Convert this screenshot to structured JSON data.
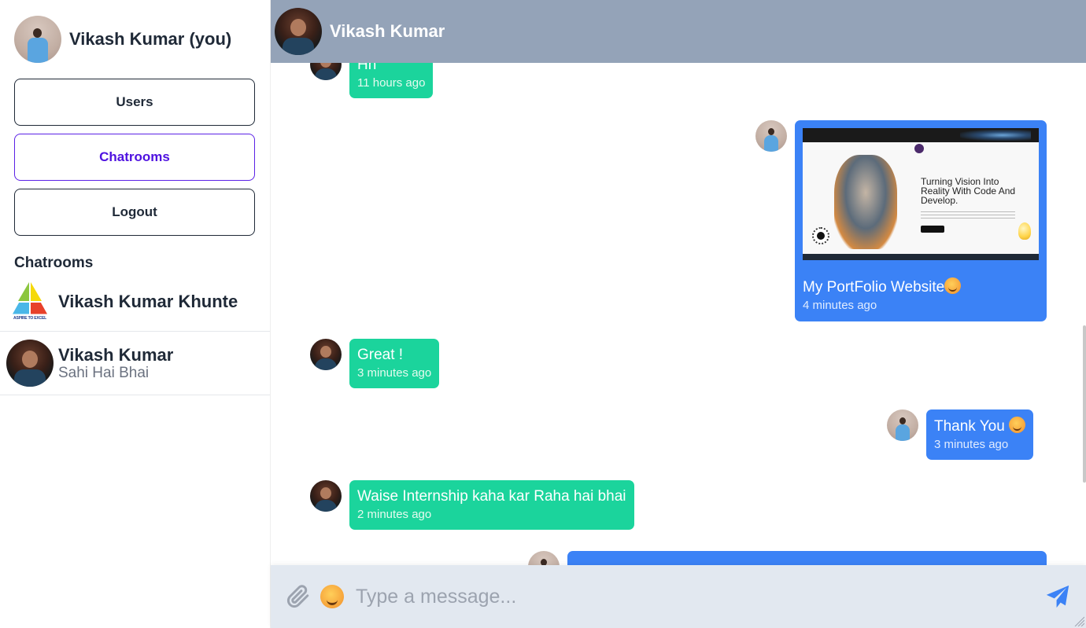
{
  "sidebar": {
    "current_user": {
      "name": "Vikash Kumar (you)",
      "avatar": "profile-photo"
    },
    "nav": [
      {
        "label": "Users",
        "active": false
      },
      {
        "label": "Chatrooms",
        "active": true
      },
      {
        "label": "Logout",
        "active": false
      }
    ],
    "section_title": "Chatrooms",
    "rooms": [
      {
        "name": "Vikash Kumar Khunte",
        "logo_caption": "ASPIRE TO EXCEL"
      }
    ],
    "direct_messages": [
      {
        "name": "Vikash Kumar",
        "last_message": "Sahi Hai Bhai"
      }
    ]
  },
  "chat": {
    "header": {
      "name": "Vikash Kumar"
    },
    "messages": [
      {
        "from": "other",
        "text": "Hh",
        "time": "11 hours ago",
        "color": "#1bd49c"
      },
      {
        "from": "me",
        "type": "image",
        "caption": "My PortFolio Website",
        "emoji": "smiling-face-emoji",
        "image_headline": "Turning Vision Into Reality With Code And Develop.",
        "time": "4 minutes ago",
        "color": "#3b82f6"
      },
      {
        "from": "other",
        "text": "Great !",
        "time": "3 minutes ago",
        "color": "#1bd49c"
      },
      {
        "from": "me",
        "text": "Thank You",
        "emoji": "smiling-face-emoji",
        "time": "3 minutes ago",
        "color": "#3b82f6"
      },
      {
        "from": "other",
        "text": "Waise Internship kaha kar Raha hai bhai",
        "time": "2 minutes ago",
        "color": "#1bd49c"
      },
      {
        "from": "me",
        "text": "",
        "time": "",
        "color": "#3b82f6",
        "partially_hidden": true
      }
    ]
  },
  "composer": {
    "placeholder": "Type a message...",
    "value": "",
    "icons": {
      "attach": "paperclip-icon",
      "emoji": "emoji-icon",
      "send": "send-icon"
    }
  },
  "colors": {
    "header_bg": "#94a3b8",
    "composer_bg": "#e2e8f0",
    "accent_active": "#4f12e0",
    "incoming_bubble": "#1bd49c",
    "outgoing_bubble": "#3b82f6"
  }
}
